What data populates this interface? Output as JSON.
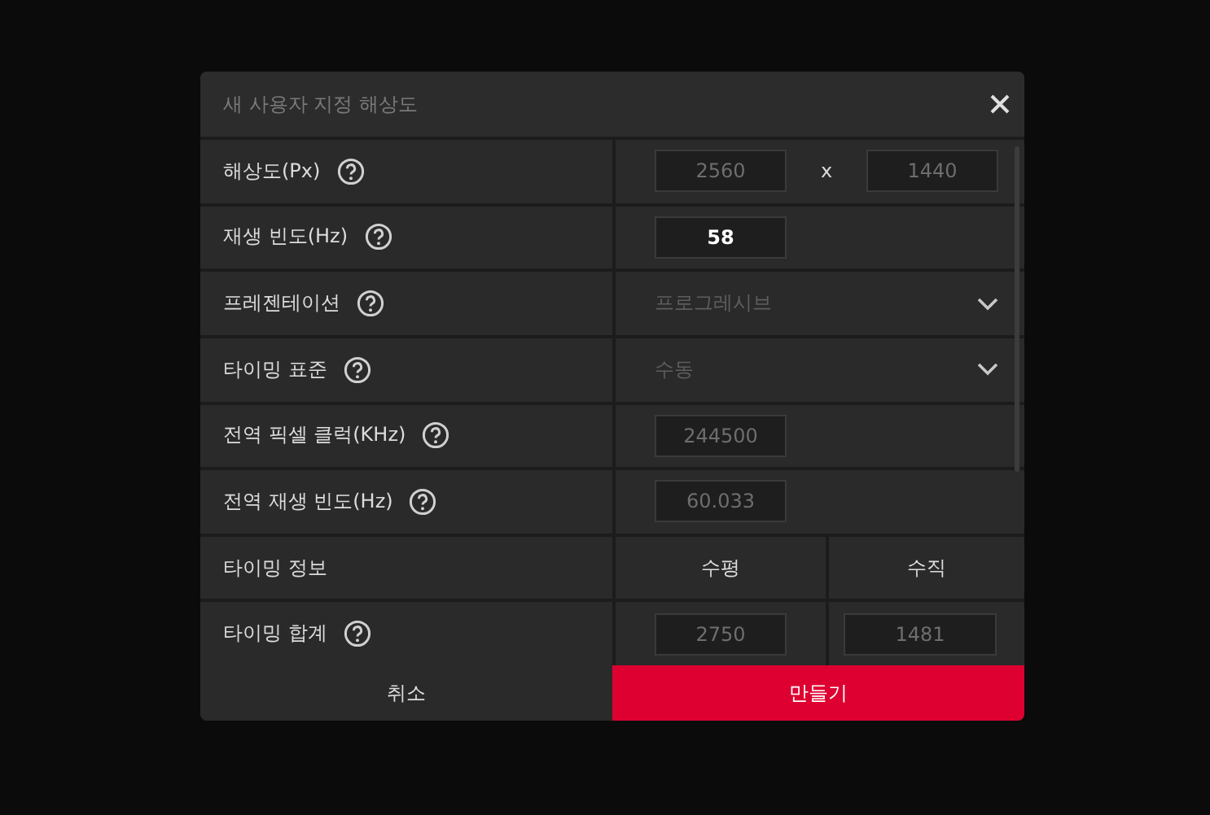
{
  "dialog": {
    "title": "새 사용자 지정 해상도",
    "rows": [
      {
        "kind": "pair",
        "label": "해상도(Px)",
        "help": true,
        "separator": "x",
        "values": [
          {
            "value": "2560",
            "disabled": true
          },
          {
            "value": "1440",
            "disabled": true
          }
        ]
      },
      {
        "kind": "input",
        "label": "재생 빈도(Hz)",
        "help": true,
        "values": [
          {
            "value": "58",
            "disabled": false
          }
        ]
      },
      {
        "kind": "select",
        "label": "프레젠테이션",
        "help": true,
        "value": "프로그레시브",
        "disabled": true
      },
      {
        "kind": "select",
        "label": "타이밍 표준",
        "help": true,
        "value": "수동",
        "disabled": true
      },
      {
        "kind": "input",
        "label": "전역 픽셀 클럭(KHz)",
        "help": true,
        "values": [
          {
            "value": "244500",
            "disabled": true
          }
        ]
      },
      {
        "kind": "input",
        "label": "전역 재생 빈도(Hz)",
        "help": true,
        "values": [
          {
            "value": "60.033",
            "disabled": true
          }
        ]
      },
      {
        "kind": "header",
        "label": "타이밍 정보",
        "help": false,
        "columns": [
          "수평",
          "수직"
        ]
      },
      {
        "kind": "split",
        "label": "타이밍 합계",
        "help": true,
        "values": [
          {
            "value": "2750",
            "disabled": true
          },
          {
            "value": "1481",
            "disabled": true
          }
        ]
      }
    ],
    "buttons": [
      {
        "label": "취소",
        "kind": "secondary"
      },
      {
        "label": "만들기",
        "kind": "primary"
      }
    ]
  }
}
